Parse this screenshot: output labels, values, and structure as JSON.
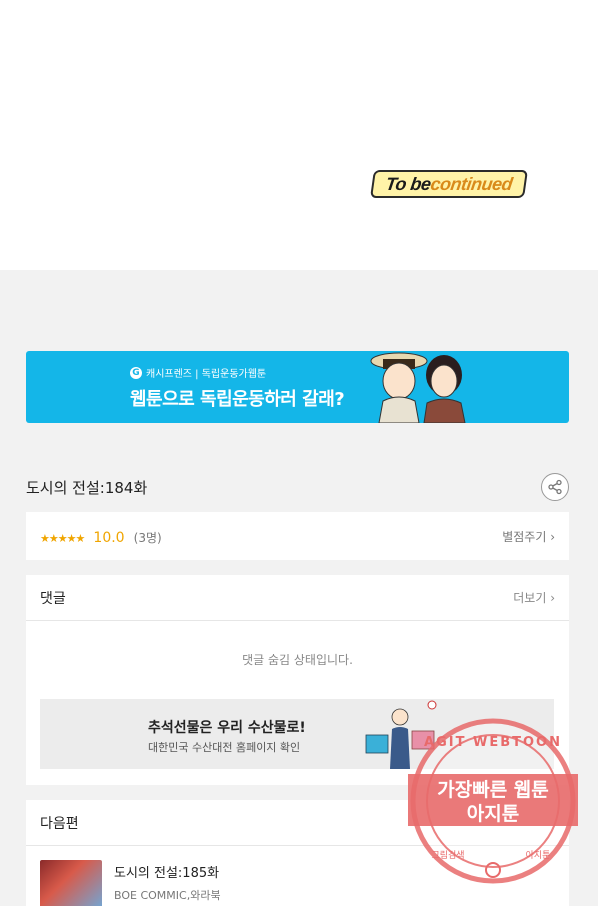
{
  "end_card": {
    "text_part1": "To be ",
    "text_part2": "continued"
  },
  "banner": {
    "brand": "G",
    "sub": "캐시프렌즈 | 독립운동가웹툰",
    "main": "웹툰으로 독립운동하러 갈래?"
  },
  "episode": {
    "title": "도시의 전설:184화"
  },
  "rating": {
    "stars": "★★★★★",
    "score": "10.0",
    "count": "(3명)",
    "rate_label": "별점주기 ›"
  },
  "comments": {
    "heading": "댓글",
    "more": "더보기 ›",
    "hidden_message": "댓글 숨김 상태입니다.",
    "ad": {
      "title": "추석선물은 우리 수산물로!",
      "subtitle": "대한민국 수산대전 홈페이지 확인"
    }
  },
  "next": {
    "heading": "다음편",
    "title": "도시의 전설:185화",
    "author": "BOE COMMIC,와라북"
  },
  "watermark": {
    "top": "AGIT WEBTOON",
    "line1": "가장빠른 웹툰",
    "line2": "아지툰",
    "bottom_left": "그림검색",
    "bottom_right": "아지툰"
  },
  "colors": {
    "banner_bg": "#14b6e8",
    "accent_star": "#f0a500",
    "stamp": "#e86a6a"
  }
}
